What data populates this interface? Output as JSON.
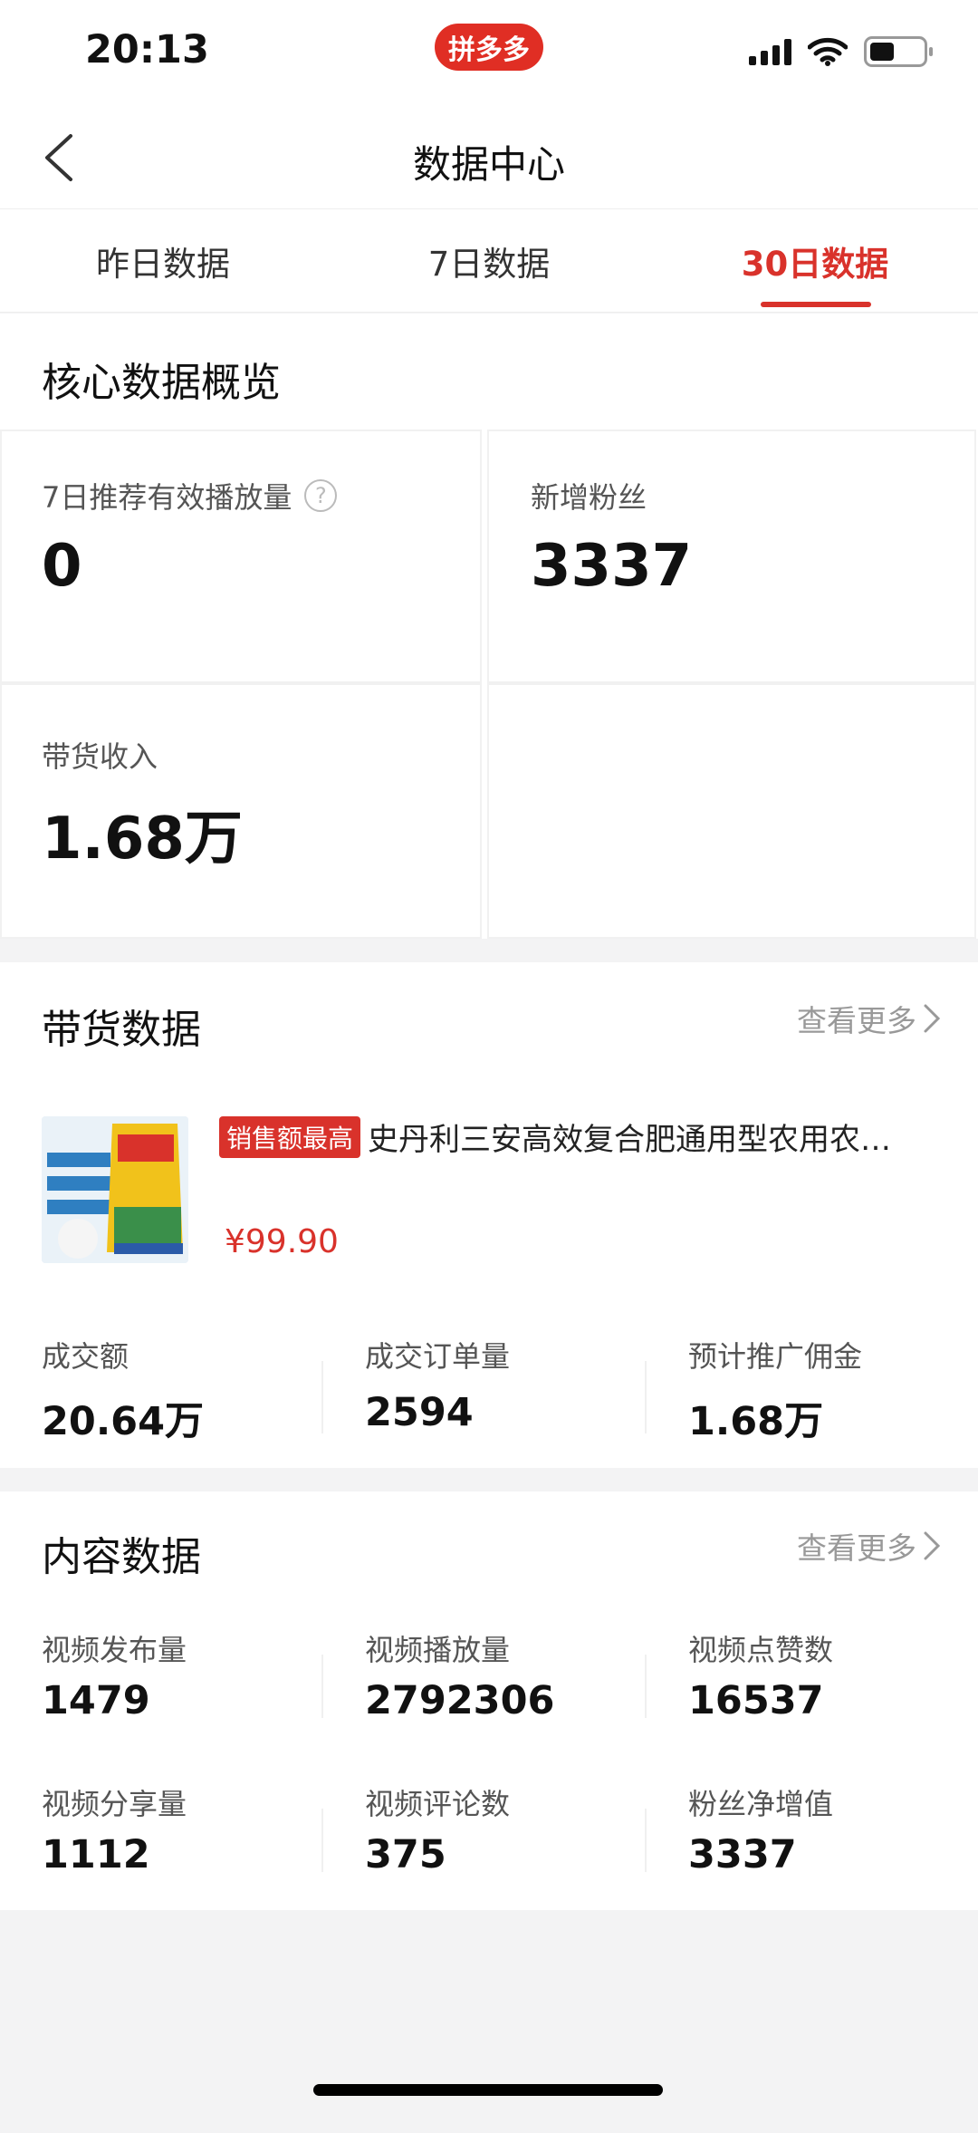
{
  "status": {
    "time": "20:13",
    "app_badge": "拼多多"
  },
  "nav": {
    "title": "数据中心"
  },
  "tabs": [
    {
      "label": "昨日数据",
      "active": false
    },
    {
      "label": "7日数据",
      "active": false
    },
    {
      "label": "30日数据",
      "active": true
    }
  ],
  "overview": {
    "title": "核心数据概览",
    "cards": [
      {
        "label": "7日推荐有效播放量",
        "value": "0"
      },
      {
        "label": "新增粉丝",
        "value": "3337"
      },
      {
        "label": "带货收入",
        "value": "1.68万"
      }
    ]
  },
  "sales": {
    "title": "带货数据",
    "see_more": "查看更多",
    "product": {
      "badge": "销售额最高",
      "name": "史丹利三安高效复合肥通用型农用农…",
      "price": "¥99.90"
    },
    "stats": [
      {
        "label": "成交额",
        "value": "20.64万"
      },
      {
        "label": "成交订单量",
        "value": "2594"
      },
      {
        "label": "预计推广佣金",
        "value": "1.68万"
      }
    ]
  },
  "content": {
    "title": "内容数据",
    "see_more": "查看更多",
    "stats": [
      {
        "label": "视频发布量",
        "value": "1479"
      },
      {
        "label": "视频播放量",
        "value": "2792306"
      },
      {
        "label": "视频点赞数",
        "value": "16537"
      },
      {
        "label": "视频分享量",
        "value": "1112"
      },
      {
        "label": "视频评论数",
        "value": "375"
      },
      {
        "label": "粉丝净增值",
        "value": "3337"
      }
    ]
  },
  "colors": {
    "accent": "#d9322b",
    "brand": "#e02e24"
  },
  "icons": [
    "back-icon",
    "help-icon",
    "chevron-right-icon",
    "signal-icon",
    "wifi-icon",
    "battery-icon"
  ]
}
